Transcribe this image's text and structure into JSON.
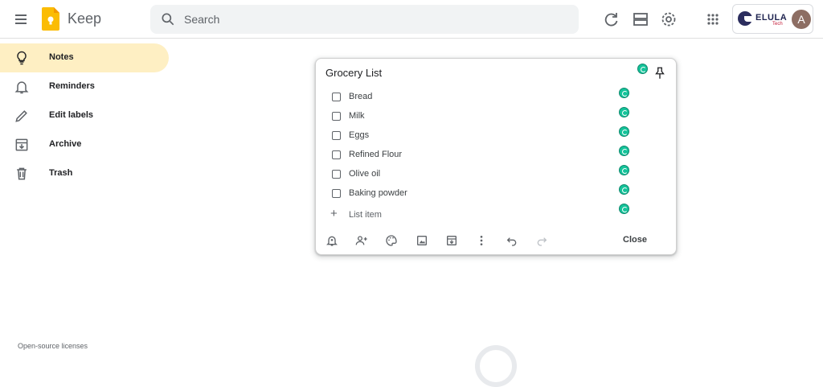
{
  "app": {
    "title": "Keep"
  },
  "search": {
    "placeholder": "Search"
  },
  "toolbar": {
    "icons": [
      "refresh-icon",
      "list-view-icon",
      "settings-gear-icon",
      "apps-grid-icon"
    ]
  },
  "account": {
    "brand_name": "ELULA",
    "brand_sub": "Tech",
    "avatar_initial": "A"
  },
  "sidebar": {
    "items": [
      {
        "label": "Notes",
        "icon": "lightbulb-icon",
        "active": true
      },
      {
        "label": "Reminders",
        "icon": "bell-icon",
        "active": false
      },
      {
        "label": "Edit labels",
        "icon": "pencil-icon",
        "active": false
      },
      {
        "label": "Archive",
        "icon": "archive-icon",
        "active": false
      },
      {
        "label": "Trash",
        "icon": "trash-icon",
        "active": false
      }
    ]
  },
  "note": {
    "title": "Grocery List",
    "items": [
      "Bread",
      "Milk",
      "Eggs",
      "Refined Flour",
      "Olive oil",
      "Baking powder"
    ],
    "add_item_label": "List item",
    "close_label": "Close",
    "tool_icons": [
      "remind-me-icon",
      "collaborator-icon",
      "background-options-icon",
      "add-image-icon",
      "archive-icon",
      "more-options-icon",
      "undo-icon",
      "redo-icon"
    ]
  },
  "footer": {
    "link": "Open-source licenses"
  },
  "colors": {
    "active_nav": "#feefc3",
    "keep_yellow": "#fbbc04",
    "grammarly_green": "#15c39a"
  }
}
